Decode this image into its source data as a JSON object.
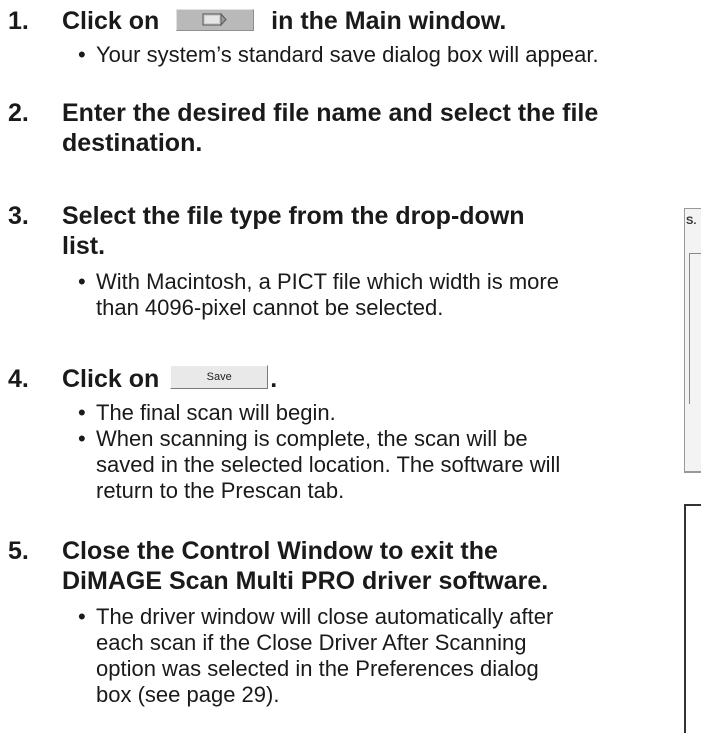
{
  "steps": [
    {
      "num": "1.",
      "before": "Click on",
      "icon": "scan-to-file-button-icon",
      "after": "in the Main window.",
      "bullets": [
        "Your system’s standard save dialog box will appear."
      ]
    },
    {
      "num": "2.",
      "lines": [
        "Enter the desired file name and select the file",
        "destination."
      ],
      "bullets": []
    },
    {
      "num": "3.",
      "lines": [
        "Select the file type from the drop-down",
        "list."
      ],
      "bullets": [
        "With Macintosh, a PICT file which width is more",
        "than 4096-pixel cannot be selected."
      ]
    },
    {
      "num": "4.",
      "before": "Click on",
      "button_label": "Save",
      "after": ".",
      "bullets": [
        "The final scan will begin.",
        "When scanning is complete, the scan will be",
        "saved in the selected location. The software will",
        "return to the Prescan tab."
      ]
    },
    {
      "num": "5.",
      "lines": [
        "Close the Control Window to exit the",
        "DiMAGE Scan Multi PRO driver software."
      ],
      "bullets": [
        "The driver window will close automatically after",
        "each scan if the Close Driver After Scanning",
        "option was selected in the Preferences dialog",
        "box (see page 29)."
      ]
    }
  ],
  "side": {
    "dialog_fragment": "S."
  },
  "colors": {
    "text": "#1a1a1a",
    "main_button": "#b9b9b9",
    "save_button": "#e9e9e9"
  }
}
